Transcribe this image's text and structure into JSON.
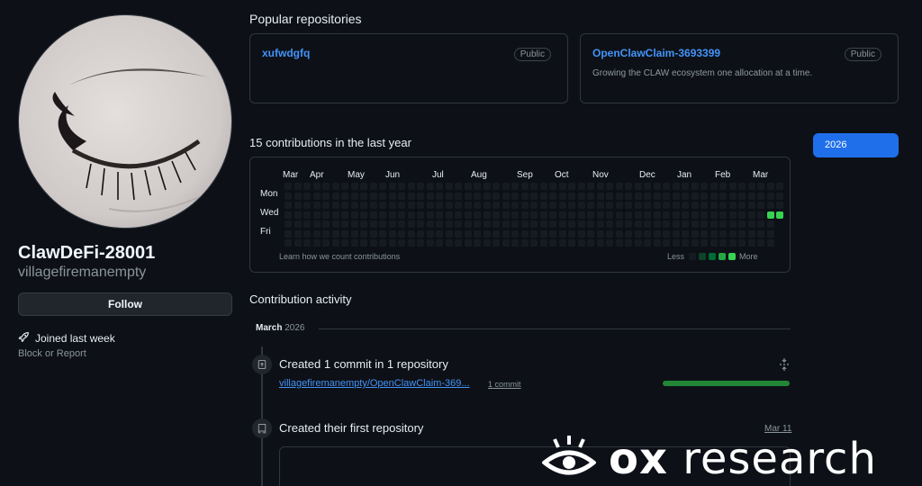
{
  "profile": {
    "display_name": "ClawDeFi-28001",
    "login": "villagefiremanempty",
    "follow_label": "Follow",
    "joined": "Joined last week",
    "block_report": "Block or Report"
  },
  "popular": {
    "title": "Popular repositories",
    "repos": [
      {
        "name": "xufwdgfq",
        "badge": "Public",
        "description": ""
      },
      {
        "name": "OpenClawClaim-3693399",
        "badge": "Public",
        "description": "Growing the CLAW ecosystem one allocation at a time."
      }
    ]
  },
  "contributions": {
    "title": "15 contributions in the last year",
    "year_button": "2026",
    "months": [
      "Mar",
      "Apr",
      "May",
      "Jun",
      "Jul",
      "Aug",
      "Sep",
      "Oct",
      "Nov",
      "Dec",
      "Jan",
      "Feb",
      "Mar"
    ],
    "days": [
      "Mon",
      "Wed",
      "Fri"
    ],
    "learn_link": "Learn how we count contributions",
    "legend_less": "Less",
    "legend_more": "More",
    "empty_color": "#161b22",
    "level_colors": [
      "#161b22",
      "#0e4429",
      "#006d32",
      "#26a641",
      "#39d353"
    ],
    "active_color": "#39d353"
  },
  "activity": {
    "title": "Contribution activity",
    "month": "March",
    "year": "2026",
    "items": [
      {
        "title": "Created 1 commit in 1 repository",
        "link": "villagefiremanempty/OpenClawClaim-369...",
        "count": "1 commit",
        "bar_fraction": 1.0
      },
      {
        "title": "Created their first repository",
        "date": "Mar 11"
      }
    ]
  },
  "watermark": {
    "brand": "ox",
    "word": "research"
  },
  "colors": {
    "accent": "#4493f8",
    "button_primary": "#1f6feb",
    "green": "#238636"
  }
}
